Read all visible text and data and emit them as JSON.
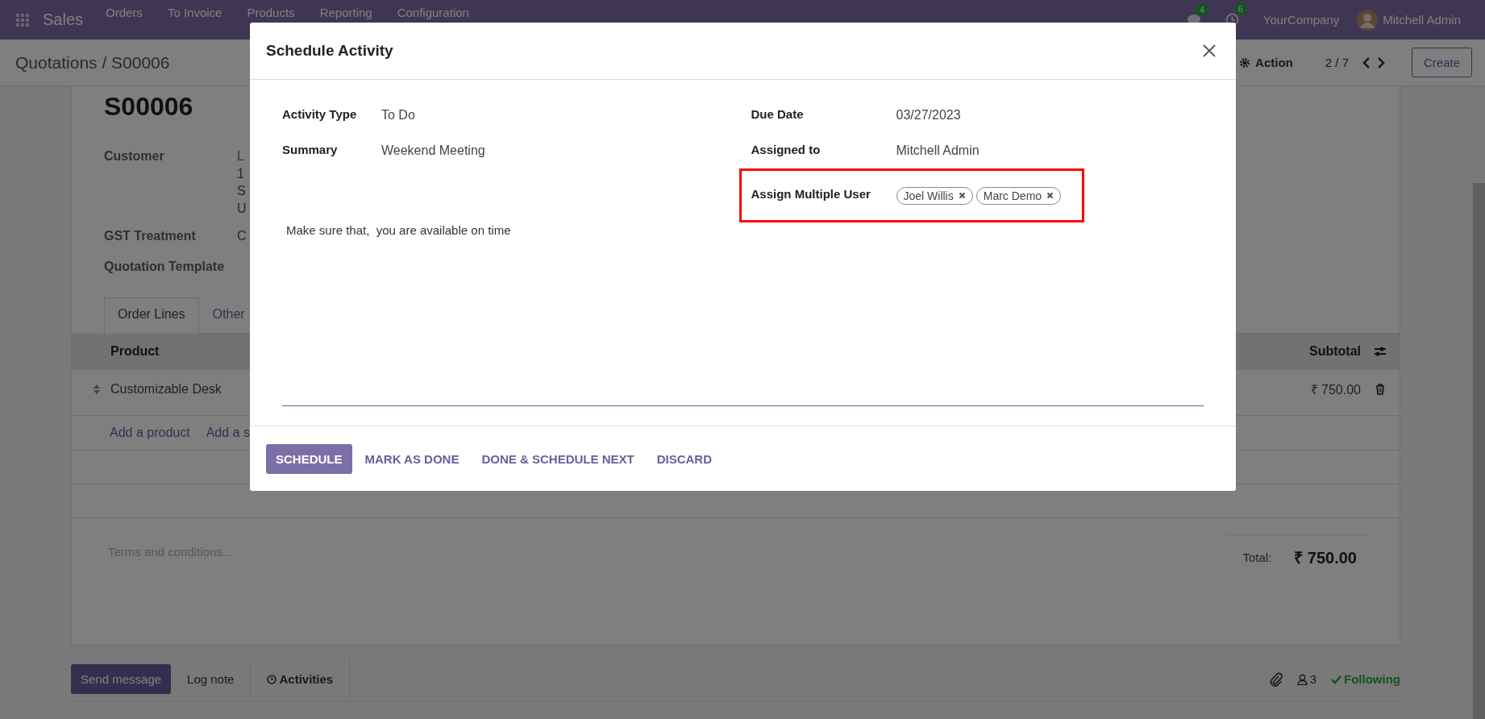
{
  "navbar": {
    "app": "Sales",
    "menus": [
      "Orders",
      "To Invoice",
      "Products",
      "Reporting",
      "Configuration"
    ],
    "chat_badge": "4",
    "activity_badge": "6",
    "company": "YourCompany",
    "user": "Mitchell Admin"
  },
  "control_panel": {
    "breadcrumb": "Quotations / S00006",
    "action": "Action",
    "pager": "2 / 7",
    "create": "Create"
  },
  "form": {
    "name": "S00006",
    "fields": [
      {
        "label": "Customer",
        "lines": [
          "L",
          "1",
          "S",
          "U"
        ]
      },
      {
        "label": "GST Treatment",
        "lines": [
          "C"
        ]
      },
      {
        "label": "Quotation Template"
      }
    ],
    "tabs": [
      {
        "label": "Order Lines",
        "selected": true
      },
      {
        "label": "Other",
        "selected": false
      }
    ],
    "columns": [
      "Product",
      "Subtotal"
    ],
    "rows": [
      {
        "product": "Customizable Desk",
        "subtotal": "₹ 750.00"
      }
    ],
    "add_links": [
      "Add a product",
      "Add a s"
    ],
    "terms_placeholder": "Terms and conditions...",
    "total_label": "Total:",
    "total": "₹ 750.00"
  },
  "chatter": {
    "send": "Send message",
    "log": "Log note",
    "activities": "Activities",
    "followers": "3",
    "follow_status": "Following"
  },
  "dialog": {
    "title": "Schedule Activity",
    "left_fields": [
      {
        "label": "Activity Type",
        "value": "To Do"
      },
      {
        "label": "Summary",
        "value": "Weekend Meeting"
      }
    ],
    "right_fields": [
      {
        "label": "Due Date",
        "value": "03/27/2023"
      },
      {
        "label": "Assigned to",
        "value": "Mitchell Admin"
      }
    ],
    "multi_user": {
      "label": "Assign Multiple User",
      "tags": [
        "Joel Willis",
        "Marc Demo"
      ],
      "highlighted": true
    },
    "note": "Make sure that,  you are available on time",
    "buttons": [
      {
        "label": "SCHEDULE",
        "kind": "primary"
      },
      {
        "label": "MARK AS DONE",
        "kind": "link"
      },
      {
        "label": "DONE & SCHEDULE NEXT",
        "kind": "link"
      },
      {
        "label": "DISCARD",
        "kind": "link"
      }
    ]
  }
}
